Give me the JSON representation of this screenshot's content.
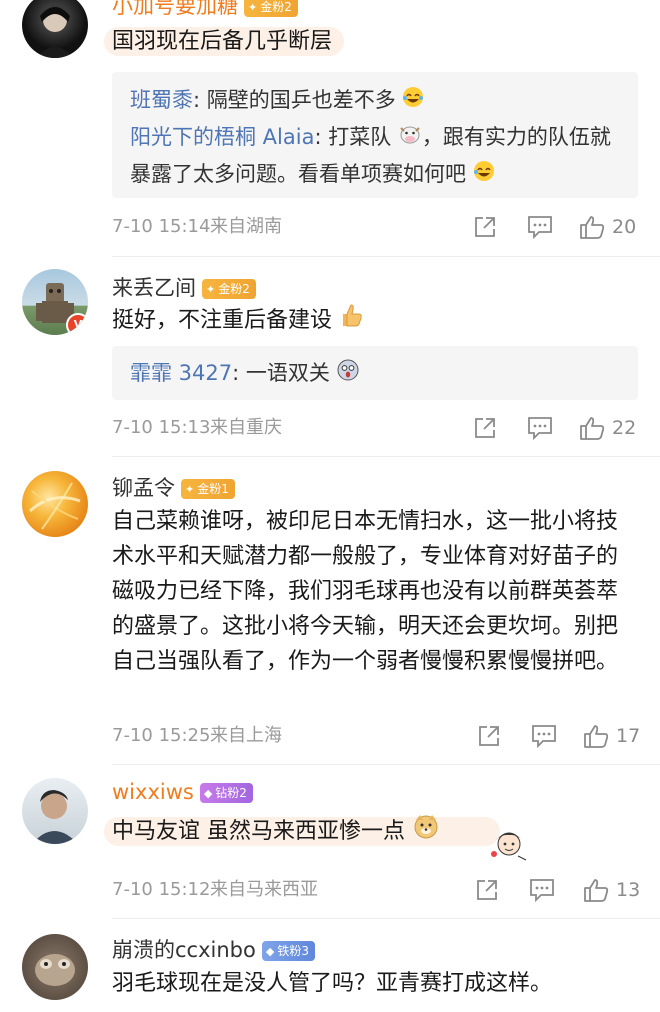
{
  "comments": [
    {
      "username": "小加号要加糖",
      "badge": "金粉2",
      "text": "国羽现在后备几乎断层",
      "replies": [
        {
          "name": "班蜀黍",
          "text": " 隔壁的国乒也差不多"
        },
        {
          "name": "阳光下的梧桐 Alaia",
          "text": " 打菜队",
          "text2": "，跟有实力的队伍就暴露了太多问题。看看单项赛如何吧"
        }
      ],
      "time": "7-10 15:14",
      "location": "来自湖南",
      "likes": "20"
    },
    {
      "username": "来丢乙间",
      "badge": "金粉2",
      "text": "挺好，不注重后备建设",
      "replies": [
        {
          "name": "霏霏 3427",
          "text": " 一语双关"
        }
      ],
      "time": "7-10 15:13",
      "location": "来自重庆",
      "likes": "22"
    },
    {
      "username": "铆孟令",
      "badge": "金粉1",
      "text": "自己菜赖谁呀，被印尼日本无情扫水，这一批小将技术水平和天赋潜力都一般般了，专业体育对好苗子的磁吸力已经下降，我们羽毛球再也没有以前群英荟萃的盛景了。这批小将今天输，明天还会更坎坷。别把自己当强队看了，作为一个弱者慢慢积累慢慢拼吧。",
      "time": "7-10 15:25",
      "location": "来自上海",
      "likes": "17"
    },
    {
      "username": "wixxiws",
      "badge": "钻粉2",
      "text": "中马友谊 虽然马来西亚惨一点",
      "time": "7-10 15:12",
      "location": "来自马来西亚",
      "likes": "13"
    },
    {
      "username": "崩溃的ccxinbo",
      "badge": "铁粉3",
      "text": "羽毛球现在是没人管了吗？亚青赛打成这样。"
    }
  ],
  "reply_colon": ":",
  "colors": {
    "reply_name": "#4e75b4",
    "orange_name": "#f07c1f",
    "gold_badge": "#f6b53e",
    "diamond_badge": "#b66fe4",
    "iron_badge": "#6b93e0",
    "meta_text": "#9a9a9a"
  },
  "icons": {
    "share": "share-icon",
    "comment": "comment-icon",
    "like": "thumbs-up-icon"
  }
}
